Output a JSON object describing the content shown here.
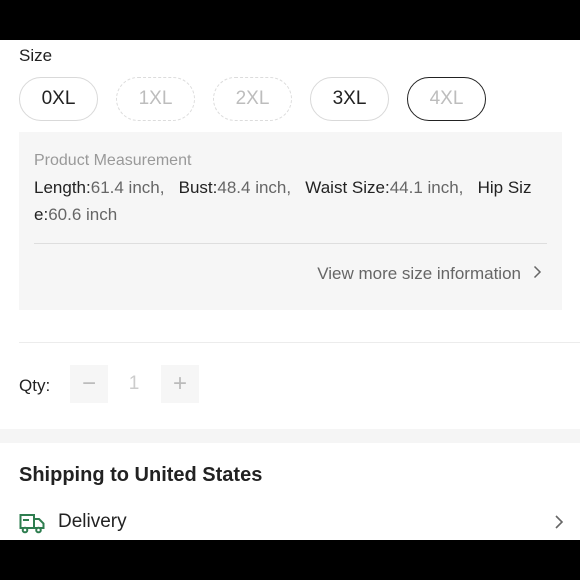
{
  "size_section": {
    "label": "Size",
    "sizes": [
      {
        "label": "0XL",
        "available": true,
        "selected": false
      },
      {
        "label": "1XL",
        "available": false,
        "selected": false
      },
      {
        "label": "2XL",
        "available": false,
        "selected": false
      },
      {
        "label": "3XL",
        "available": true,
        "selected": false
      },
      {
        "label": "4XL",
        "available": false,
        "selected": true
      }
    ]
  },
  "measurement": {
    "title": "Product Measurement",
    "line1": {
      "length_key": "Length:",
      "length_val": "61.4 inch,",
      "bust_key": "Bust:",
      "bust_val": "48.4 inch,",
      "waist_key": "Waist Size:",
      "waist_val": "44.1 inch,",
      "hip_key_part1": "Hip Siz"
    },
    "line2": {
      "hip_key_part2": "e:",
      "hip_val": "60.6 inch"
    },
    "more_link": "View more size information"
  },
  "quantity": {
    "label": "Qty:",
    "value": "1",
    "minus": "−",
    "plus": "+"
  },
  "shipping": {
    "title": "Shipping to United States",
    "delivery_label": "Delivery"
  },
  "icons": {
    "more_chevron": "chevron-right-icon",
    "delivery": "truck-icon",
    "delivery_chevron": "chevron-right-icon"
  },
  "colors": {
    "accent_icon": "#2e7d4f",
    "box_bg": "#f6f6f6",
    "selected_border": "#222222",
    "disabled_text": "#bdbdbd"
  }
}
